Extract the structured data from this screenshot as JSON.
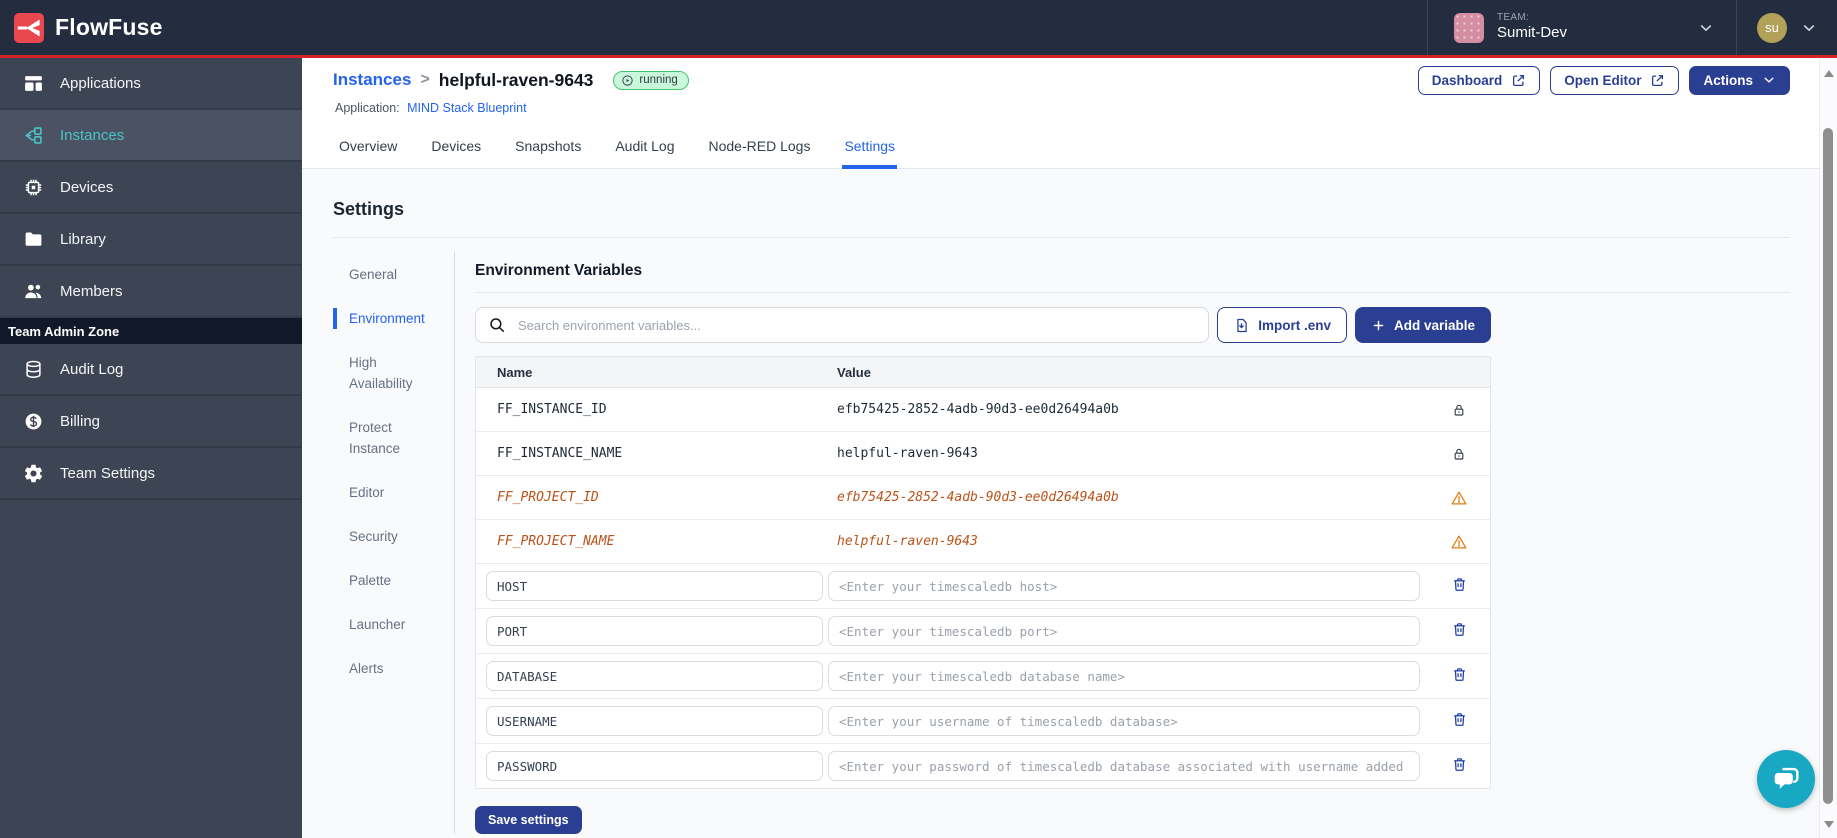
{
  "colors": {
    "brand_red": "#D2232A",
    "topbar_bg": "#232D3F",
    "sidebar_bg": "#3D4554",
    "sidebar_active_teal": "#4CC4C7",
    "link_blue": "#2563EB",
    "button_navy": "#2B3F92",
    "running_badge_bg": "#C9F7D9",
    "running_badge_border": "#41C46F",
    "deprecated_orange": "#B9531A",
    "warning_orange": "#E07C12",
    "chat_teal": "#18A8C3"
  },
  "topbar": {
    "brand": "FlowFuse",
    "team_label": "TEAM:",
    "team_name": "Sumit-Dev",
    "user_initials": "su"
  },
  "sidebar": {
    "items": [
      {
        "id": "applications",
        "label": "Applications",
        "icon": "applications-icon",
        "active": false
      },
      {
        "id": "instances",
        "label": "Instances",
        "icon": "instances-icon",
        "active": true
      },
      {
        "id": "devices",
        "label": "Devices",
        "icon": "devices-icon",
        "active": false
      },
      {
        "id": "library",
        "label": "Library",
        "icon": "library-icon",
        "active": false
      },
      {
        "id": "members",
        "label": "Members",
        "icon": "members-icon",
        "active": false
      }
    ],
    "admin_zone_label": "Team Admin Zone",
    "admin_items": [
      {
        "id": "audit-log",
        "label": "Audit Log",
        "icon": "audit-log-icon",
        "active": false
      },
      {
        "id": "billing",
        "label": "Billing",
        "icon": "billing-icon",
        "active": false
      },
      {
        "id": "team-settings",
        "label": "Team Settings",
        "icon": "team-settings-icon",
        "active": false
      }
    ]
  },
  "header": {
    "breadcrumb_parent": "Instances",
    "breadcrumb_separator": ">",
    "instance_name": "helpful-raven-9643",
    "status_badge": "running",
    "application_label": "Application:",
    "application_name": "MIND Stack Blueprint",
    "dashboard_button": "Dashboard",
    "open_editor_button": "Open Editor",
    "actions_button": "Actions"
  },
  "tabs": [
    {
      "label": "Overview",
      "active": false
    },
    {
      "label": "Devices",
      "active": false
    },
    {
      "label": "Snapshots",
      "active": false
    },
    {
      "label": "Audit Log",
      "active": false
    },
    {
      "label": "Node-RED Logs",
      "active": false
    },
    {
      "label": "Settings",
      "active": true
    }
  ],
  "settings": {
    "title": "Settings",
    "nav": [
      {
        "label": "General",
        "active": false
      },
      {
        "label": "Environment",
        "active": true
      },
      {
        "label": "High Availability",
        "active": false
      },
      {
        "label": "Protect Instance",
        "active": false
      },
      {
        "label": "Editor",
        "active": false
      },
      {
        "label": "Security",
        "active": false
      },
      {
        "label": "Palette",
        "active": false
      },
      {
        "label": "Launcher",
        "active": false
      },
      {
        "label": "Alerts",
        "active": false
      }
    ]
  },
  "env": {
    "title": "Environment Variables",
    "search_placeholder": "Search environment variables...",
    "import_button": "Import .env",
    "add_button": "Add variable",
    "save_button": "Save settings",
    "table": {
      "columns": [
        "Name",
        "Value"
      ],
      "rows": [
        {
          "type": "locked",
          "name": "FF_INSTANCE_ID",
          "value": "efb75425-2852-4adb-90d3-ee0d26494a0b"
        },
        {
          "type": "locked",
          "name": "FF_INSTANCE_NAME",
          "value": "helpful-raven-9643"
        },
        {
          "type": "deprecated",
          "name": "FF_PROJECT_ID",
          "value": "efb75425-2852-4adb-90d3-ee0d26494a0b"
        },
        {
          "type": "deprecated",
          "name": "FF_PROJECT_NAME",
          "value": "helpful-raven-9643"
        },
        {
          "type": "editable",
          "name": "HOST",
          "placeholder": "<Enter your timescaledb host>"
        },
        {
          "type": "editable",
          "name": "PORT",
          "placeholder": "<Enter your timescaledb port>"
        },
        {
          "type": "editable",
          "name": "DATABASE",
          "placeholder": "<Enter your timescaledb database name>"
        },
        {
          "type": "editable",
          "name": "USERNAME",
          "placeholder": "<Enter your username of timescaledb database>"
        },
        {
          "type": "editable",
          "name": "PASSWORD",
          "placeholder": "<Enter your password of timescaledb database associated with username added"
        }
      ]
    }
  }
}
